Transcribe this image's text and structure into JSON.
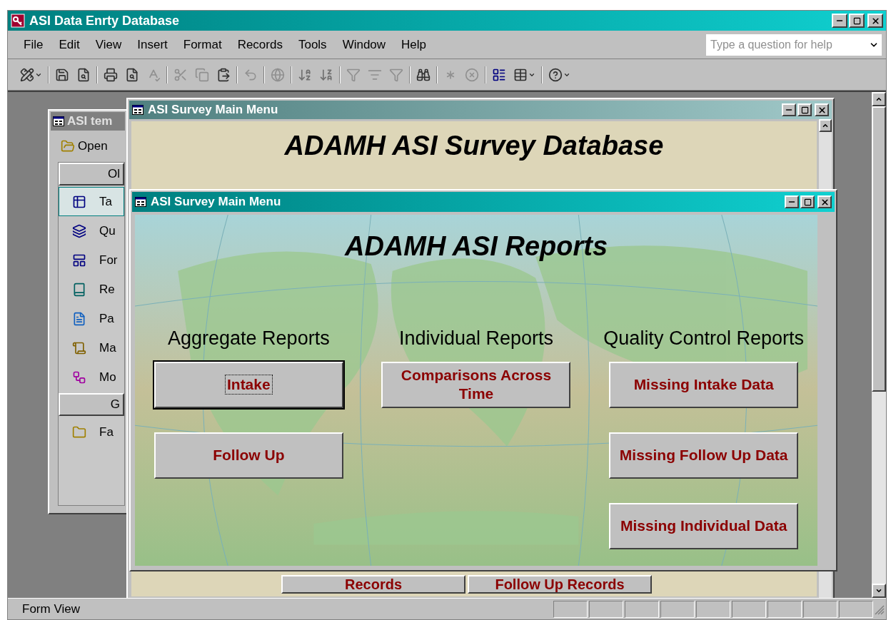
{
  "app": {
    "title": "ASI Data Enrty Database"
  },
  "menu": [
    {
      "label": "File"
    },
    {
      "label": "Edit"
    },
    {
      "label": "View"
    },
    {
      "label": "Insert"
    },
    {
      "label": "Format"
    },
    {
      "label": "Records"
    },
    {
      "label": "Tools"
    },
    {
      "label": "Window"
    },
    {
      "label": "Help"
    }
  ],
  "help_box": {
    "placeholder": "Type a question for help"
  },
  "db_window": {
    "title": "ASI tem",
    "open_button": "Open",
    "groups": [
      {
        "label": "Ol",
        "items": [
          {
            "label": "Ta",
            "kind": "tables",
            "selected": true
          },
          {
            "label": "Qu",
            "kind": "queries",
            "selected": false
          },
          {
            "label": "For",
            "kind": "forms",
            "selected": false
          },
          {
            "label": "Re",
            "kind": "reports",
            "selected": false
          },
          {
            "label": "Pa",
            "kind": "pages",
            "selected": false
          },
          {
            "label": "Ma",
            "kind": "macros",
            "selected": false
          },
          {
            "label": "Mo",
            "kind": "modules",
            "selected": false
          }
        ]
      },
      {
        "label": "G",
        "items": [
          {
            "label": "Fa",
            "kind": "favorites",
            "selected": false
          }
        ]
      }
    ]
  },
  "back_form": {
    "title": "ASI Survey Main Menu",
    "heading": "ADAMH ASI Survey Database",
    "buttons": [
      "Records",
      "Follow Up Records"
    ]
  },
  "front_form": {
    "title": "ASI Survey Main Menu",
    "heading": "ADAMH ASI Reports",
    "columns": [
      {
        "heading": "Aggregate Reports",
        "buttons": [
          {
            "label": "Intake",
            "focused": true
          },
          {
            "label": "Follow Up",
            "focused": false
          }
        ]
      },
      {
        "heading": "Individual Reports",
        "buttons": [
          {
            "label": "Comparisons Across Time",
            "focused": false
          }
        ]
      },
      {
        "heading": "Quality Control Reports",
        "buttons": [
          {
            "label": "Missing Intake Data",
            "focused": false
          },
          {
            "label": "Missing Follow Up Data",
            "focused": false
          },
          {
            "label": "Missing Individual Data",
            "focused": false
          }
        ]
      }
    ]
  },
  "status_bar": {
    "text": "Form View"
  }
}
